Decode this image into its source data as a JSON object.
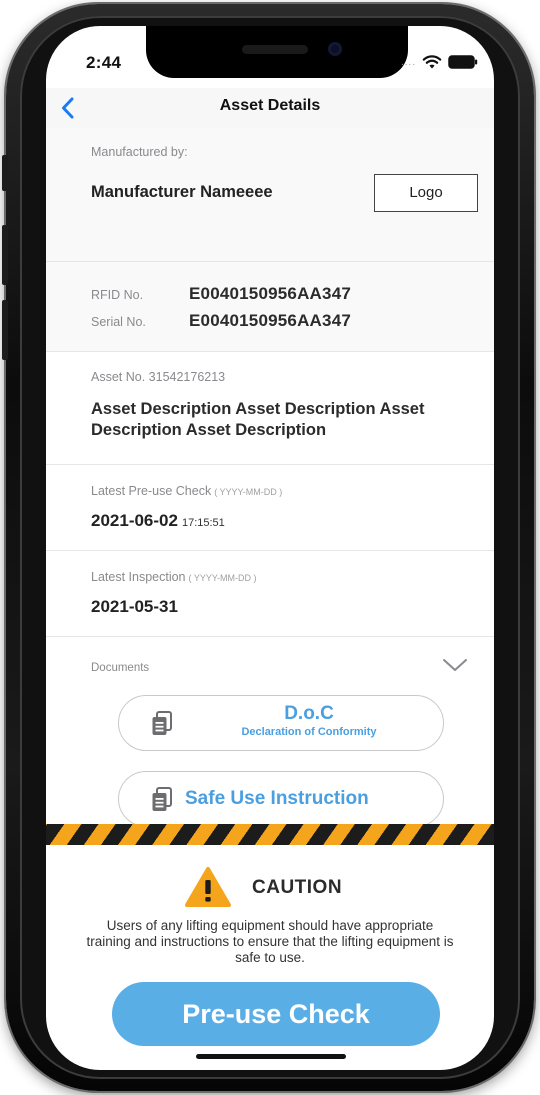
{
  "status_bar": {
    "time": "2:44",
    "signal": "....",
    "wifi_icon": "wifi-icon",
    "battery_icon": "battery-icon"
  },
  "nav": {
    "back_icon": "chevron-left-icon",
    "title": "Asset Details"
  },
  "manufacturer": {
    "label": "Manufactured by:",
    "name": "Manufacturer Nameeee",
    "logo_label": "Logo"
  },
  "identifiers": {
    "rfid_label": "RFID No.",
    "rfid_value": "E0040150956AA347",
    "serial_label": "Serial No.",
    "serial_value": "E0040150956AA347"
  },
  "asset": {
    "number_text": "Asset No. 31542176213",
    "description": "Asset Description Asset Description Asset Description Asset Description"
  },
  "pre_use_check": {
    "label": "Latest Pre-use Check",
    "format": "( YYYY-MM-DD )",
    "date": "2021-06-02",
    "time": "17:15:51"
  },
  "inspection": {
    "label": "Latest Inspection",
    "format": "( YYYY-MM-DD )",
    "date": "2021-05-31"
  },
  "documents": {
    "label": "Documents",
    "items": [
      {
        "title": "D.o.C",
        "subtitle": "Declaration of Conformity",
        "icon": "document-icon"
      },
      {
        "title": "Safe Use Instruction",
        "icon": "document-icon"
      }
    ]
  },
  "caution": {
    "title": "CAUTION",
    "text": "Users of any lifting equipment should have appropriate training and instructions to ensure that the lifting equipment is safe to use."
  },
  "action": {
    "pre_use_button": "Pre-use Check"
  },
  "colors": {
    "accent_blue": "#4a9fe0",
    "button_blue": "#5aaee6",
    "hazard_yellow": "#f4a51c",
    "hazard_black": "#1c1c1c",
    "ios_blue": "#1a7cf5"
  }
}
